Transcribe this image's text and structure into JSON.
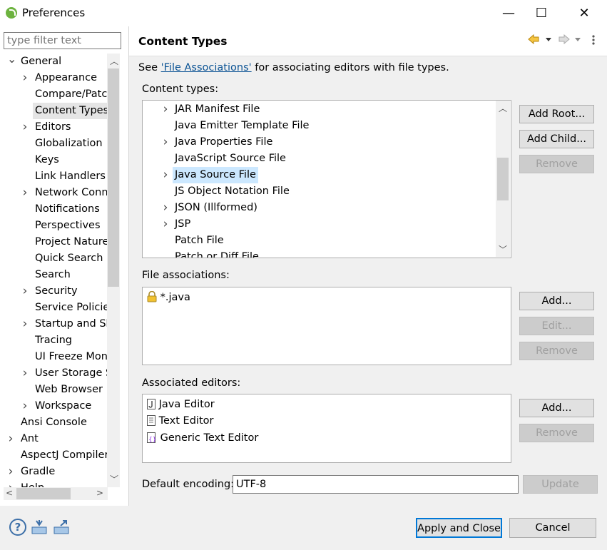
{
  "window": {
    "title": "Preferences",
    "minimize": "—",
    "maximize": "☐",
    "close": "✕"
  },
  "filter": {
    "placeholder": "type filter text"
  },
  "tree": [
    {
      "label": "General",
      "level": 0,
      "chev": "down"
    },
    {
      "label": "Appearance",
      "level": 1,
      "chev": "right"
    },
    {
      "label": "Compare/Patch",
      "level": 1,
      "chev": ""
    },
    {
      "label": "Content Types",
      "level": 1,
      "chev": "",
      "selected": true
    },
    {
      "label": "Editors",
      "level": 1,
      "chev": "right"
    },
    {
      "label": "Globalization",
      "level": 1,
      "chev": ""
    },
    {
      "label": "Keys",
      "level": 1,
      "chev": ""
    },
    {
      "label": "Link Handlers",
      "level": 1,
      "chev": ""
    },
    {
      "label": "Network Conn",
      "level": 1,
      "chev": "right"
    },
    {
      "label": "Notifications",
      "level": 1,
      "chev": ""
    },
    {
      "label": "Perspectives",
      "level": 1,
      "chev": ""
    },
    {
      "label": "Project Natures",
      "level": 1,
      "chev": ""
    },
    {
      "label": "Quick Search",
      "level": 1,
      "chev": ""
    },
    {
      "label": "Search",
      "level": 1,
      "chev": ""
    },
    {
      "label": "Security",
      "level": 1,
      "chev": "right"
    },
    {
      "label": "Service Policies",
      "level": 1,
      "chev": ""
    },
    {
      "label": "Startup and Sh",
      "level": 1,
      "chev": "right"
    },
    {
      "label": "Tracing",
      "level": 1,
      "chev": ""
    },
    {
      "label": "UI Freeze Mon",
      "level": 1,
      "chev": ""
    },
    {
      "label": "User Storage S",
      "level": 1,
      "chev": "right"
    },
    {
      "label": "Web Browser",
      "level": 1,
      "chev": ""
    },
    {
      "label": "Workspace",
      "level": 1,
      "chev": "right"
    },
    {
      "label": "Ansi Console",
      "level": 0,
      "chev": ""
    },
    {
      "label": "Ant",
      "level": 0,
      "chev": "right"
    },
    {
      "label": "AspectJ Compiler",
      "level": 0,
      "chev": ""
    },
    {
      "label": "Gradle",
      "level": 0,
      "chev": "right"
    },
    {
      "label": "Help",
      "level": 0,
      "chev": "right"
    }
  ],
  "page": {
    "title": "Content Types",
    "see_prefix": "See ",
    "see_link": "'File Associations'",
    "see_suffix": " for associating editors with file types.",
    "content_types_label": "Content types:",
    "content_types": [
      {
        "label": "JAR Manifest File",
        "chev": true
      },
      {
        "label": "Java Emitter Template File",
        "chev": false
      },
      {
        "label": "Java Properties File",
        "chev": true
      },
      {
        "label": "JavaScript Source File",
        "chev": false
      },
      {
        "label": "Java Source File",
        "chev": true,
        "selected": true
      },
      {
        "label": "JS Object Notation File",
        "chev": false
      },
      {
        "label": "JSON (Illformed)",
        "chev": true
      },
      {
        "label": "JSP",
        "chev": true
      },
      {
        "label": "Patch File",
        "chev": false
      },
      {
        "label": "Patch or Diff File",
        "chev": false
      }
    ],
    "add_root": "Add Root...",
    "add_child": "Add Child...",
    "remove": "Remove",
    "file_assoc_label": "File associations:",
    "file_assoc": [
      {
        "label": "*.java",
        "icon": "lock-icon"
      }
    ],
    "add": "Add...",
    "edit": "Edit...",
    "assoc_editors_label": "Associated editors:",
    "editors": [
      {
        "label": "Java Editor",
        "icon": "java-file-icon"
      },
      {
        "label": "Text Editor",
        "icon": "text-file-icon"
      },
      {
        "label": "Generic Text Editor",
        "icon": "generic-editor-icon"
      }
    ],
    "default_encoding_label": "Default encoding:",
    "default_encoding": "UTF-8",
    "update": "Update"
  },
  "bottom": {
    "apply_close": "Apply and Close",
    "cancel": "Cancel"
  }
}
